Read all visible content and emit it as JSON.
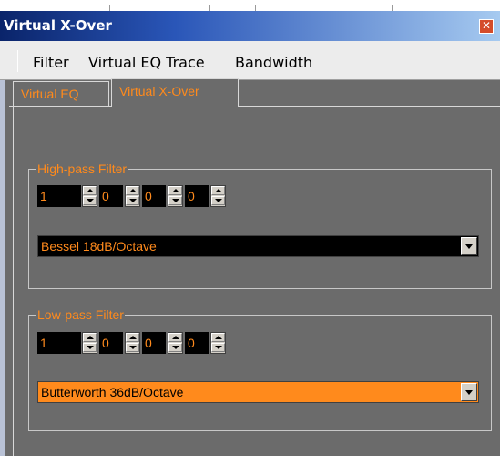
{
  "window": {
    "title": "Virtual X-Over",
    "close_glyph": "✕"
  },
  "menu": {
    "items": [
      "Filter",
      "Virtual EQ Trace",
      "Bandwidth"
    ]
  },
  "tabs": [
    {
      "label": "Virtual EQ",
      "selected": false
    },
    {
      "label": "Virtual X-Over",
      "selected": true
    }
  ],
  "high_pass": {
    "title": "High-pass Filter",
    "spinners": [
      "1",
      "0",
      "0",
      "0"
    ],
    "filter_type": "Bessel 18dB/Octave"
  },
  "low_pass": {
    "title": "Low-pass Filter",
    "spinners": [
      "1",
      "0",
      "0",
      "0"
    ],
    "filter_type": "Butterworth 36dB/Octave"
  },
  "colors": {
    "accent": "#ff8a1c",
    "panel_bg": "#6b6b6b",
    "title_bar": "#0a246a"
  }
}
